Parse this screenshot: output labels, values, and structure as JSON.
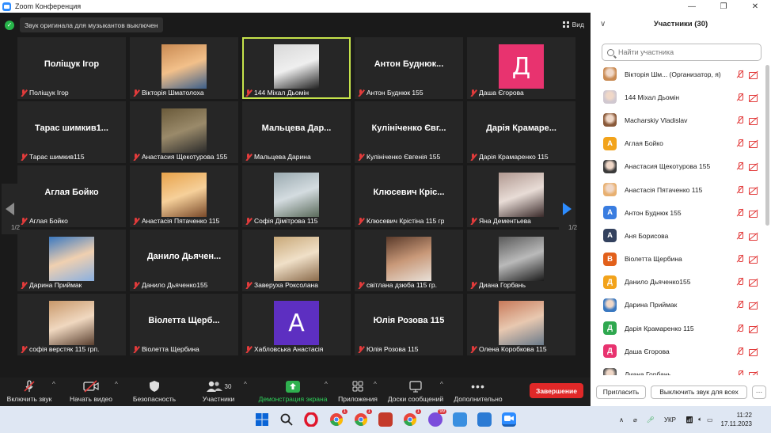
{
  "window": {
    "title": "Zoom Конференция",
    "controls": [
      "—",
      "❐",
      "✕"
    ]
  },
  "stage": {
    "audio_notice": "Звук оригинала для музыкантов выключен",
    "view_label": "Вид",
    "page_left": "1/2",
    "page_right": "1/2"
  },
  "tiles": [
    {
      "name": "Поліщук Ігор",
      "label": "Поліщук Ігор",
      "type": "text"
    },
    {
      "name": "",
      "label": "Вікторія Шматолоха",
      "type": "photo",
      "colors": [
        "#c98a52",
        "#f2c08a",
        "#3c5f8a"
      ]
    },
    {
      "name": "",
      "label": "144 Міхал Дьомін",
      "type": "photo",
      "active": true,
      "colors": [
        "#d8d8d8",
        "#efefef",
        "#222222"
      ]
    },
    {
      "name": "Антон Буднюк...",
      "label": "Антон Буднюк 155",
      "type": "text"
    },
    {
      "name": "",
      "label": "Даша Єгорова",
      "type": "letter",
      "letter": "Д",
      "color": "#e8336f"
    },
    {
      "name": "Тарас шимкив1...",
      "label": "Тарас шимкив115",
      "type": "text"
    },
    {
      "name": "",
      "label": "Анастасия Щекотурова 155",
      "type": "photo",
      "colors": [
        "#6a5a3a",
        "#9a8a6a",
        "#2a2a2a"
      ]
    },
    {
      "name": "Мальцева Дар...",
      "label": "Мальцева Дарина",
      "type": "text"
    },
    {
      "name": "Кулініченко Євг...",
      "label": "Кулініченко Євгенія 155",
      "type": "text"
    },
    {
      "name": "Дарія Крамаре...",
      "label": "Дарія Крамаренко 115",
      "type": "text"
    },
    {
      "name": "Аглая Бойко",
      "label": "Аглая Бойко",
      "type": "text"
    },
    {
      "name": "",
      "label": "Анастасія Пятаченко 115",
      "type": "photo",
      "colors": [
        "#e8a24a",
        "#f6d09a",
        "#7a4a2a"
      ]
    },
    {
      "name": "",
      "label": "Софія Дімітрова 115",
      "type": "photo",
      "colors": [
        "#9aaab0",
        "#d4dce0",
        "#5a6a5a"
      ]
    },
    {
      "name": "Клюсевич Кріс...",
      "label": "Клюсевич Крістіна 115 гр",
      "type": "text"
    },
    {
      "name": "",
      "label": "Яна Дементьева",
      "type": "photo",
      "colors": [
        "#b09890",
        "#e8dcd6",
        "#3a2a2a"
      ]
    },
    {
      "name": "",
      "label": "Дарина Приймак",
      "type": "photo",
      "colors": [
        "#3a78c0",
        "#f0d0b0",
        "#8ab0e0"
      ]
    },
    {
      "name": "Данило Дьячен...",
      "label": "Данило Дьяченко155",
      "type": "text"
    },
    {
      "name": "",
      "label": "Заверуха Роксолана",
      "type": "photo",
      "colors": [
        "#c8a878",
        "#f0e0c8",
        "#8a6a4a"
      ]
    },
    {
      "name": "",
      "label": "світлана дзюба 115 гр.",
      "type": "photo",
      "colors": [
        "#5a3a2a",
        "#c89878",
        "#e8e0d8"
      ]
    },
    {
      "name": "",
      "label": "Диана Горбань",
      "type": "photo",
      "colors": [
        "#5a5a5a",
        "#bababa",
        "#1a1a1a"
      ]
    },
    {
      "name": "",
      "label": "софія верстяк 115 грп.",
      "type": "photo",
      "colors": [
        "#c8986a",
        "#f0d8c0",
        "#5a4030"
      ]
    },
    {
      "name": "Віолетта Щерб...",
      "label": "Віолетта Щербина",
      "type": "text"
    },
    {
      "name": "",
      "label": "Хабловська Анастасія",
      "type": "letter",
      "letter": "А",
      "color": "#5d2fc1"
    },
    {
      "name": "Юлія Розова 115",
      "label": "Юлія Розова 115",
      "type": "text"
    },
    {
      "name": "",
      "label": "Олена Коробкова 115",
      "type": "photo",
      "colors": [
        "#c87a5a",
        "#e8c8b0",
        "#6a7a8a"
      ]
    }
  ],
  "toolbar": {
    "mute": "Включить звук",
    "video": "Начать видео",
    "security": "Безопасность",
    "participants": "Участники",
    "participants_count": "30",
    "share": "Демонстрация экрана",
    "apps": "Приложения",
    "whiteboard": "Доски сообщений",
    "more": "Дополнительно",
    "end": "Завершение"
  },
  "panel": {
    "title": "Участники (30)",
    "search_placeholder": "Найти участника",
    "participants": [
      {
        "name": "Вікторія Шм...  (Организатор, я)",
        "avatar": "photo",
        "color": "#c98a52"
      },
      {
        "name": "144 Міхал Дьомін",
        "avatar": "photo",
        "color": "#d0c8d0"
      },
      {
        "name": "Macharskiy Vladislav",
        "avatar": "photo",
        "color": "#8a5a3a"
      },
      {
        "name": "Аглая Бойко",
        "avatar": "letter",
        "letter": "А",
        "color": "#f2a31b"
      },
      {
        "name": "Анастасия Щекотурова 155",
        "avatar": "photo",
        "color": "#3a3a3a"
      },
      {
        "name": "Анастасія Пятаченко 115",
        "avatar": "photo",
        "color": "#e8b070"
      },
      {
        "name": "Антон Буднюк 155",
        "avatar": "letter",
        "letter": "А",
        "color": "#3a7de0"
      },
      {
        "name": "Аня Борисова",
        "avatar": "letter",
        "letter": "А",
        "color": "#33415e"
      },
      {
        "name": "Віолетта Щербина",
        "avatar": "letter",
        "letter": "В",
        "color": "#e2601b"
      },
      {
        "name": "Данило Дьяченко155",
        "avatar": "letter",
        "letter": "Д",
        "color": "#f2a31b"
      },
      {
        "name": "Дарина Приймак",
        "avatar": "photo",
        "color": "#3a78c0"
      },
      {
        "name": "Дарія Крамаренко 115",
        "avatar": "letter",
        "letter": "Д",
        "color": "#2fa84f"
      },
      {
        "name": "Даша Єгорова",
        "avatar": "letter",
        "letter": "Д",
        "color": "#e8336f"
      },
      {
        "name": "Диана Горбань",
        "avatar": "photo",
        "color": "#555555"
      }
    ],
    "invite": "Пригласить",
    "mute_all": "Выключить звук для всех",
    "more": "···"
  },
  "taskbar": {
    "lang": "УКР",
    "time": "11:22",
    "date": "17.11.2023",
    "badges": [
      "1",
      "1",
      "1"
    ],
    "chat_badge": "99"
  }
}
